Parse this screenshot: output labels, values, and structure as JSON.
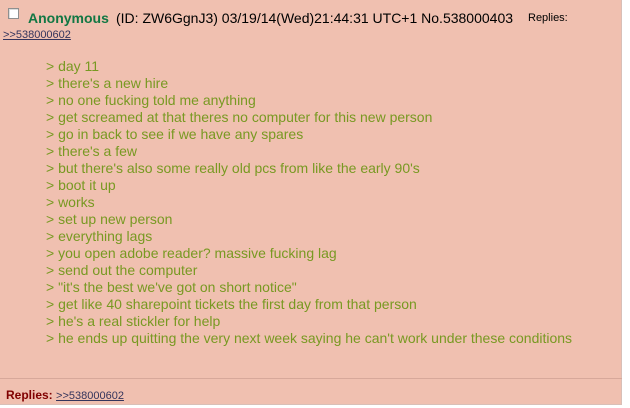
{
  "post": {
    "checkbox": {
      "checked": false
    },
    "name": "Anonymous",
    "meta": "(ID: ZW6GgnJ3) 03/19/14(Wed)21:44:31 UTC+1 No.538000403",
    "replies_label": "Replies:",
    "reply_link": ">>538000602",
    "greentext_lines": [
      "> day 11",
      "> there's a new hire",
      "> no one fucking told me anything",
      "> get screamed at that theres no computer for this new person",
      "> go in back to see if we have any spares",
      "> there's a few",
      "> but there's also some really old pcs from like the early 90's",
      "> boot it up",
      "> works",
      "> set up new person",
      "> everything lags",
      "> you open adobe reader? massive fucking lag",
      "> send out the computer",
      "> \"it's the best we've got on short notice\"",
      "> get like 40 sharepoint tickets the first day from that person",
      "> he's a real stickler for help",
      "> he ends up quitting the very next week saying he can't work under these conditions"
    ],
    "footer": {
      "label": "Replies:",
      "link": ">>538000602"
    }
  },
  "colors": {
    "post_bg": "#f0c0b0",
    "name": "#117743",
    "greentext": "#789922",
    "link": "#34345c",
    "footer_label": "#800000"
  }
}
